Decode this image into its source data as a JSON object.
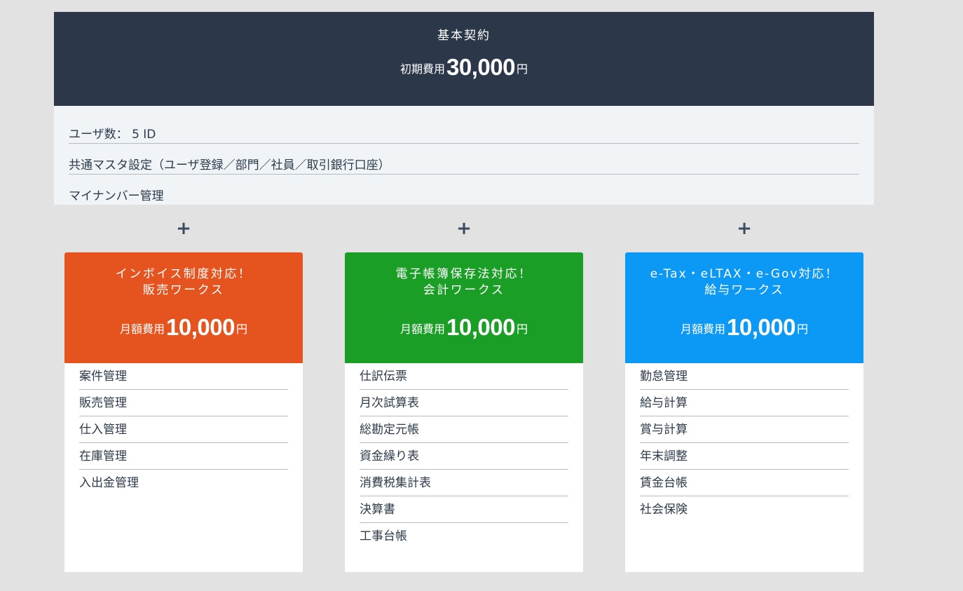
{
  "base": {
    "title": "基本契約",
    "price_prefix": "初期費用",
    "price": "30,000",
    "price_unit": "円",
    "features": [
      "ユーザ数： 5 ID",
      "共通マスタ設定（ユーザ登録／部門／社員／取引銀行口座）",
      "マイナンバー管理"
    ]
  },
  "plus_symbol": "+",
  "cards": [
    {
      "title_line1": "インボイス制度対応！",
      "title_line2": "販売ワークス",
      "price_prefix": "月額費用",
      "price": "10,000",
      "price_unit": "円",
      "color": "#e5531e",
      "items": [
        "案件管理",
        "販売管理",
        "仕入管理",
        "在庫管理",
        "入出金管理"
      ]
    },
    {
      "title_line1": "電子帳簿保存法対応！",
      "title_line2": "会計ワークス",
      "price_prefix": "月額費用",
      "price": "10,000",
      "price_unit": "円",
      "color": "#1b9e25",
      "items": [
        "仕訳伝票",
        "月次試算表",
        "総勘定元帳",
        "資金繰り表",
        "消費税集計表",
        "決算書",
        "工事台帳"
      ]
    },
    {
      "title_line1": "e-Tax・eLTAX・e-Gov対応！",
      "title_line2": "給与ワークス",
      "price_prefix": "月額費用",
      "price": "10,000",
      "price_unit": "円",
      "color": "#0c99f5",
      "items": [
        "勤怠管理",
        "給与計算",
        "賞与計算",
        "年末調整",
        "賃金台帳",
        "社会保険"
      ]
    }
  ]
}
